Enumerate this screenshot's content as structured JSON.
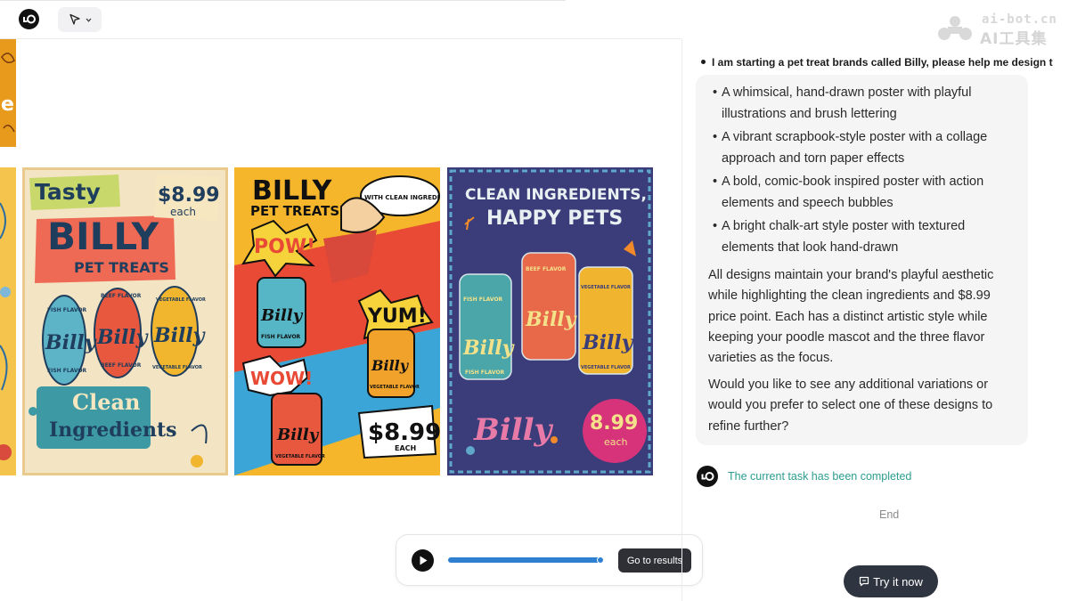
{
  "toolbar": {
    "logo_icon": "lo-logo-icon",
    "tool_icon": "cursor-arrow-icon",
    "tool_dropdown_icon": "chevron-down-icon"
  },
  "watermark": {
    "line1": "ai-bot.cn",
    "line2": "AI工具集"
  },
  "canvas": {
    "posters": [
      {
        "headline_top": "Tasty",
        "headline": "BILLY",
        "subhead": "PET TREATS",
        "price": "$8.99",
        "price_unit": "each",
        "cans": [
          {
            "flavor_top": "FISH FLAVOR",
            "brand": "Billy",
            "flavor_bottom": "FISH FLAVOR"
          },
          {
            "flavor_top": "BEEF FLAVOR",
            "brand": "Billy",
            "flavor_bottom": "BEEF FLAVOR"
          },
          {
            "flavor_top": "VEGETABLE FLAVOR",
            "brand": "Billy",
            "flavor_bottom": "VEGETABLE FLAVOR"
          }
        ],
        "tagline_1": "Clean",
        "tagline_2": "Ingredients"
      },
      {
        "headline": "BILLY",
        "subhead": "PET TREATS",
        "bubble": "WITH CLEAN INGREDIENTS!",
        "burst_1": "POW!",
        "burst_2": "YUM!",
        "burst_3": "WOW!",
        "can_brand": "Billy",
        "can_flavor": "FISH FLAVOR",
        "can_brand_2": "Billy",
        "can_flavor_2": "VEGETABLE FLAVOR",
        "can_brand_3": "Billy",
        "can_flavor_3": "VEGETABLE FLAVOR",
        "price": "$8.99",
        "price_unit": "EACH"
      },
      {
        "headline_1": "CLEAN INGREDIENTS,",
        "headline_2": "HAPPY PETS",
        "cans": [
          {
            "flavor_top": "FISH FLAVOR",
            "brand": "Billy",
            "flavor_bottom": "FISH FLAVOR"
          },
          {
            "flavor_top": "BEEF FLAVOR",
            "brand": "Billy",
            "flavor_bottom": ""
          },
          {
            "flavor_top": "VEGETABLE FLAVOR",
            "brand": "Billy",
            "flavor_bottom": "VEGETABLE FLAVOR"
          }
        ],
        "signature": "Billy",
        "price": "8.99",
        "price_unit": "each"
      }
    ]
  },
  "player": {
    "play_icon": "play-icon",
    "progress": 0.98,
    "results_label": "Go to results"
  },
  "chat": {
    "user_message": "I am starting a pet treat brands called Billy, please help me design t",
    "bullets": [
      "A whimsical, hand-drawn poster with playful illustrations and brush lettering",
      "A vibrant scrapbook-style poster with a collage approach and torn paper effects",
      "A bold, comic-book inspired poster with action elements and speech bubbles",
      "A bright chalk-art style poster with textured elements that look hand-drawn"
    ],
    "paragraph_1": "All designs maintain your brand's playful aesthetic while highlighting the clean ingredients and $8.99 price point. Each has a distinct artistic style while keeping your poodle mascot and the three flavor varieties as the focus.",
    "paragraph_2": "Would you like to see any additional variations or would you prefer to select one of these designs to refine further?",
    "status_text": "The current task has been completed",
    "end_label": "End",
    "try_label": "Try it now",
    "try_icon": "chat-square-icon"
  }
}
